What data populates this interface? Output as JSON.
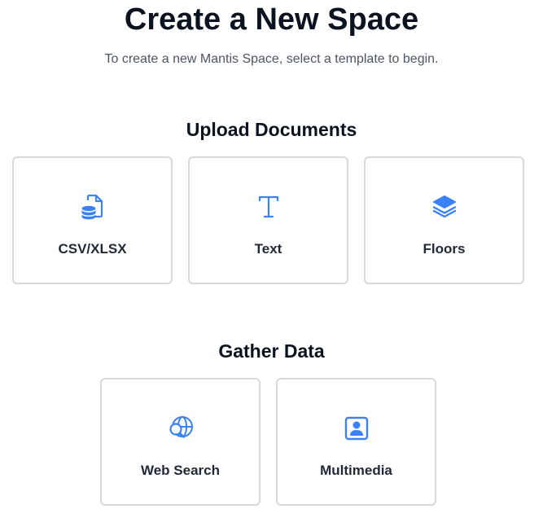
{
  "header": {
    "title": "Create a New Space",
    "subtitle": "To create a new Mantis Space, select a template to begin."
  },
  "sections": [
    {
      "heading": "Upload Documents",
      "cards": [
        {
          "label": "CSV/XLSX",
          "icon": "file-database-icon"
        },
        {
          "label": "Text",
          "icon": "text-icon"
        },
        {
          "label": "Floors",
          "icon": "layers-icon"
        }
      ]
    },
    {
      "heading": "Gather Data",
      "cards": [
        {
          "label": "Web Search",
          "icon": "web-search-icon"
        },
        {
          "label": "Multimedia",
          "icon": "portrait-icon"
        }
      ]
    }
  ],
  "colors": {
    "accent": "#3b82f6",
    "card_border": "#d9d9d9",
    "title": "#0b1220",
    "subtitle": "#4b5563"
  }
}
